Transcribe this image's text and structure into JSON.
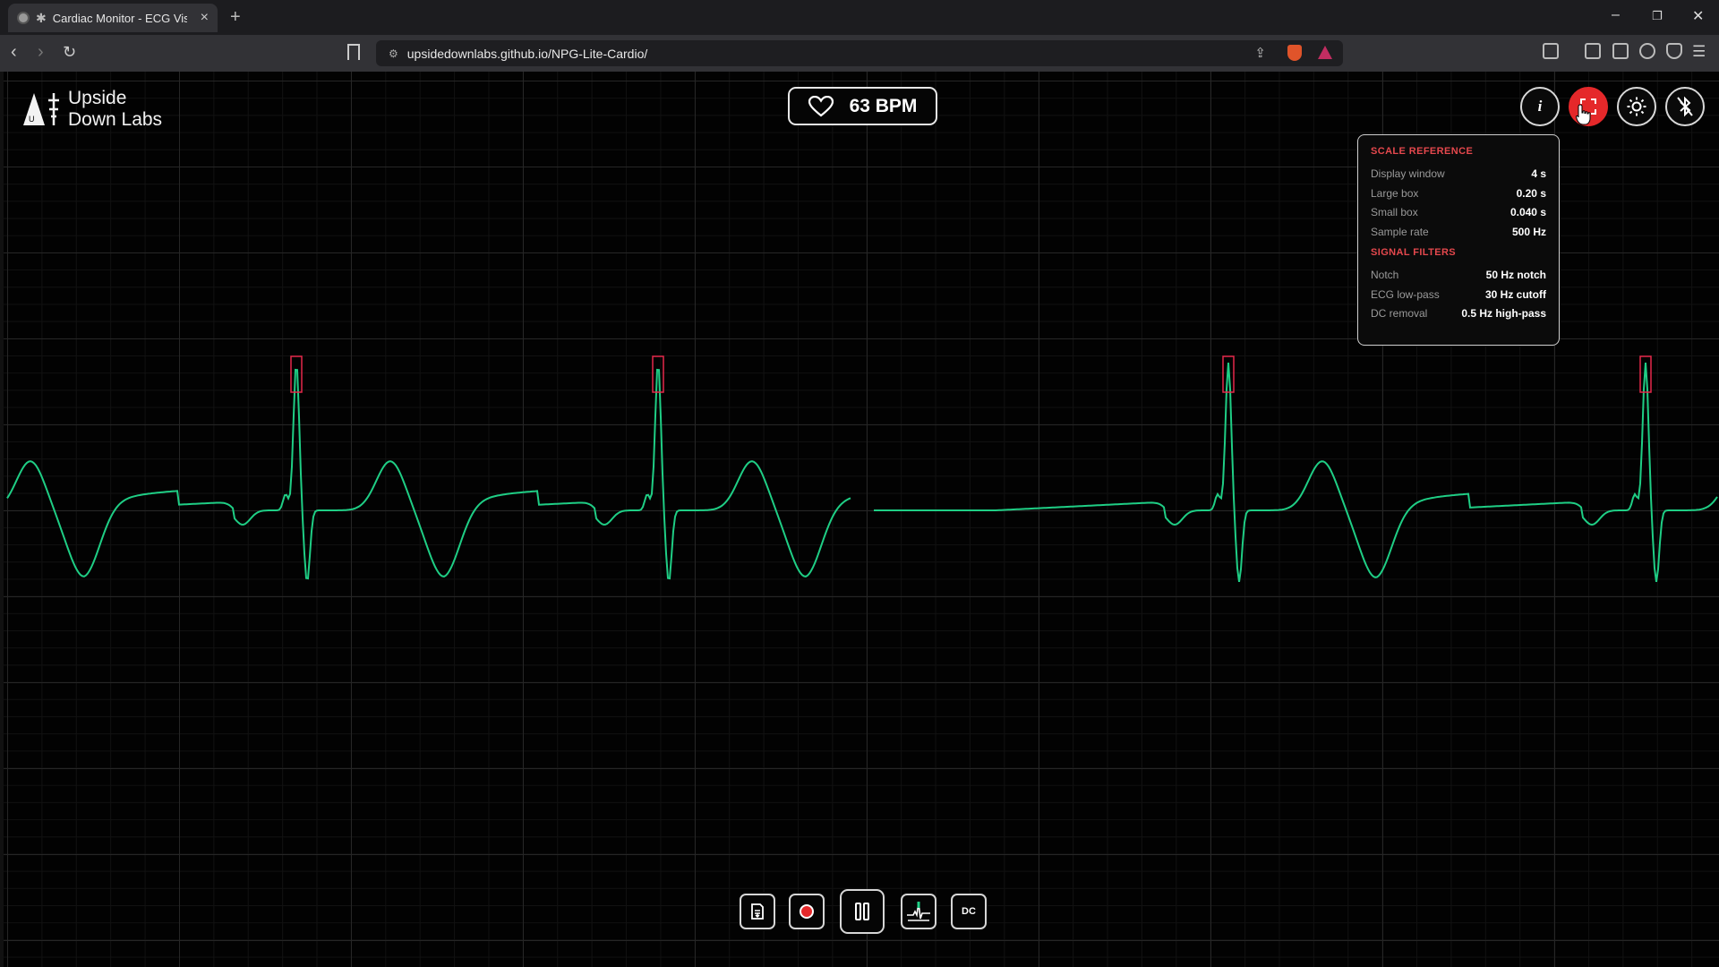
{
  "browser": {
    "tab_title": "Cardiac Monitor - ECG Visuali",
    "tab_close": "×",
    "new_tab": "+",
    "url": "upsidedownlabs.github.io/NPG-Lite-Cardio/"
  },
  "app": {
    "logo_line1": "Upside",
    "logo_line2": "Down Labs",
    "bpm_value": "63 BPM",
    "buttons": [
      "info-icon",
      "fullscreen-icon",
      "brightness-icon",
      "bluetooth-off-icon"
    ],
    "active_button_color": "#e5282a",
    "trace_color": "#1fce85",
    "peak_marker_color": "#e5284a"
  },
  "scale_panel": {
    "section1_title": "SCALE REFERENCE",
    "scale_rows": [
      {
        "label": "Display window",
        "value": "4 s"
      },
      {
        "label": "Large box",
        "value": "0.20 s"
      },
      {
        "label": "Small box",
        "value": "0.040 s"
      },
      {
        "label": "Sample rate",
        "value": "500 Hz"
      }
    ],
    "section2_title": "SIGNAL FILTERS",
    "filter_rows": [
      {
        "label": "Notch",
        "value": "50 Hz notch"
      },
      {
        "label": "ECG low-pass",
        "value": "30 Hz cutoff"
      },
      {
        "label": "DC removal",
        "value": "0.5 Hz high-pass"
      }
    ]
  },
  "controls": {
    "items": [
      "save-icon",
      "record-icon",
      "pause-icon",
      "peak-marker-icon",
      "dc-button"
    ],
    "dc_label": "DC"
  }
}
